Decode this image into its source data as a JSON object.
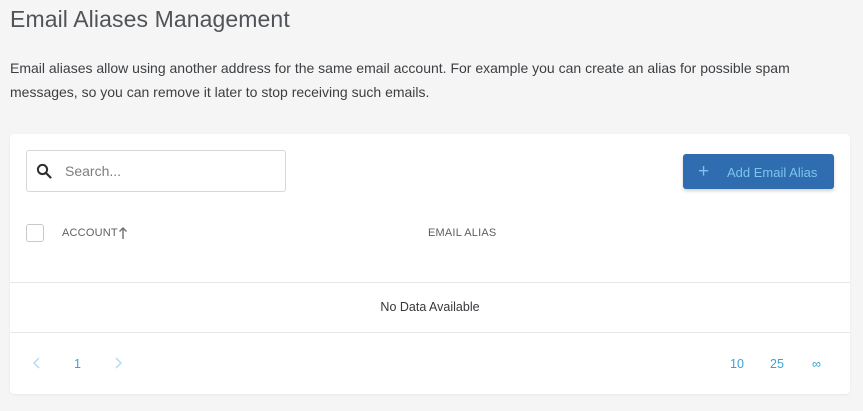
{
  "page": {
    "title": "Email Aliases Management",
    "description": "Email aliases allow using another address for the same email account. For example you can create an alias for possible spam messages, so you can remove it later to stop receiving such emails."
  },
  "toolbar": {
    "search_placeholder": "Search...",
    "search_icon": "search-icon",
    "add_button_icon": "plus-icon",
    "add_button_label": "Add Email Alias"
  },
  "table": {
    "columns": [
      {
        "label": "ACCOUNT",
        "sort": "ascending"
      },
      {
        "label": "EMAIL ALIAS"
      }
    ],
    "rows": [],
    "empty_message": "No Data Available"
  },
  "pagination": {
    "prev_icon": "chevron-left-icon",
    "next_icon": "chevron-right-icon",
    "pages": [
      "1"
    ],
    "current_page": "1",
    "page_sizes": [
      "10",
      "25",
      "∞"
    ]
  },
  "colors": {
    "background": "#f5f5f6",
    "card": "#ffffff",
    "primary_button": "#2f6db0",
    "primary_button_text": "#7dc4ee",
    "link": "#3aa3d6",
    "disabled_chevron": "#b9dff3"
  }
}
